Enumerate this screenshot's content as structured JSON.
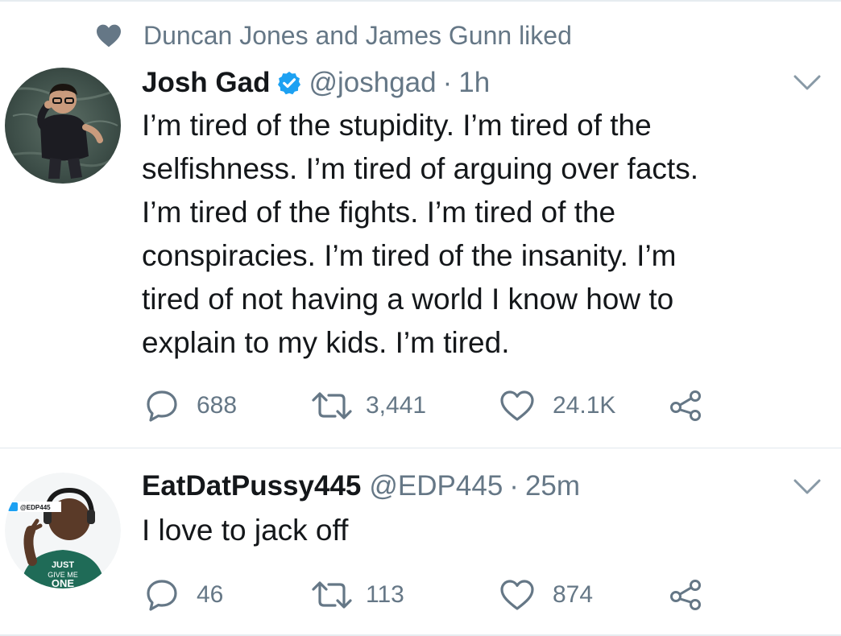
{
  "colors": {
    "primary_text": "#14171a",
    "secondary_text": "#657786",
    "verified_blue": "#1da1f2",
    "divider": "#e1e8ed"
  },
  "tweets": [
    {
      "social_context": {
        "icon": "heart-icon",
        "text": "Duncan Jones and James Gunn liked"
      },
      "author": {
        "name": "Josh Gad",
        "verified": true,
        "handle": "@joshgad",
        "separator": "·",
        "time": "1h"
      },
      "text": "I’m tired of the stupidity. I’m tired of the\nselfishness. I’m tired of arguing over facts.\nI’m tired of the fights. I’m tired of the\nconspiracies. I’m tired of the insanity. I’m\ntired of not having a world I know how to\nexplain to my kids. I’m tired.",
      "actions": {
        "replies": "688",
        "retweets": "3,441",
        "likes": "24.1K"
      }
    },
    {
      "author": {
        "name": "EatDatPussy445",
        "verified": false,
        "handle": "@EDP445",
        "separator": "·",
        "time": "25m"
      },
      "text": "I love to jack off",
      "actions": {
        "replies": "46",
        "retweets": "113",
        "likes": "874"
      },
      "avatar_overlay_text": "@EDP445"
    }
  ]
}
